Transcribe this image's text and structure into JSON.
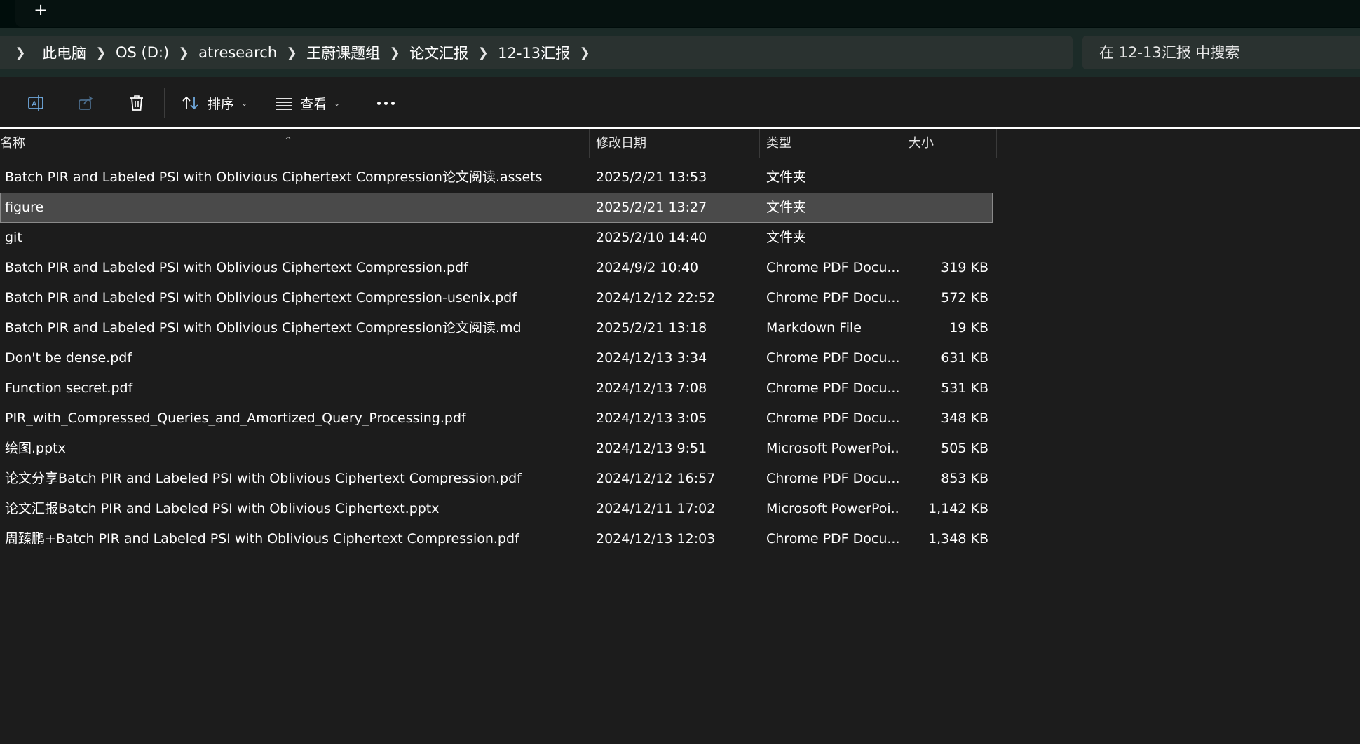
{
  "titlebar": {
    "new_tab_label": "+"
  },
  "address": {
    "breadcrumbs": [
      "此电脑",
      "OS (D:)",
      "atresearch",
      "王蔚课题组",
      "论文汇报",
      "12-13汇报"
    ],
    "search_placeholder": "在 12-13汇报 中搜索"
  },
  "toolbar": {
    "rename_icon": "rename-icon",
    "share_icon": "share-icon",
    "delete_icon": "trash-icon",
    "sort_label": "排序",
    "view_label": "查看",
    "more_icon": "more-icon"
  },
  "columns": {
    "name": "名称",
    "date": "修改日期",
    "type": "类型",
    "size": "大小"
  },
  "files": [
    {
      "name": "Batch PIR and Labeled PSI with Oblivious Ciphertext Compression论文阅读.assets",
      "date": "2025/2/21 13:53",
      "type": "文件夹",
      "size": ""
    },
    {
      "name": "figure",
      "date": "2025/2/21 13:27",
      "type": "文件夹",
      "size": "",
      "selected": true
    },
    {
      "name": "git",
      "date": "2025/2/10 14:40",
      "type": "文件夹",
      "size": ""
    },
    {
      "name": "Batch PIR and Labeled PSI with Oblivious Ciphertext Compression.pdf",
      "date": "2024/9/2 10:40",
      "type": "Chrome PDF Docu...",
      "size": "319 KB"
    },
    {
      "name": "Batch PIR and Labeled PSI with Oblivious Ciphertext Compression-usenix.pdf",
      "date": "2024/12/12 22:52",
      "type": "Chrome PDF Docu...",
      "size": "572 KB"
    },
    {
      "name": "Batch PIR and Labeled PSI with Oblivious Ciphertext Compression论文阅读.md",
      "date": "2025/2/21 13:18",
      "type": "Markdown File",
      "size": "19 KB"
    },
    {
      "name": "Don't be dense.pdf",
      "date": "2024/12/13 3:34",
      "type": "Chrome PDF Docu...",
      "size": "631 KB"
    },
    {
      "name": "Function secret.pdf",
      "date": "2024/12/13 7:08",
      "type": "Chrome PDF Docu...",
      "size": "531 KB"
    },
    {
      "name": "PIR_with_Compressed_Queries_and_Amortized_Query_Processing.pdf",
      "date": "2024/12/13 3:05",
      "type": "Chrome PDF Docu...",
      "size": "348 KB"
    },
    {
      "name": "绘图.pptx",
      "date": "2024/12/13 9:51",
      "type": "Microsoft PowerPoi...",
      "size": "505 KB"
    },
    {
      "name": "论文分享Batch PIR and Labeled PSI with Oblivious Ciphertext Compression.pdf",
      "date": "2024/12/12 16:57",
      "type": "Chrome PDF Docu...",
      "size": "853 KB"
    },
    {
      "name": "论文汇报Batch PIR and Labeled PSI with Oblivious Ciphertext.pptx",
      "date": "2024/12/11 17:02",
      "type": "Microsoft PowerPoi...",
      "size": "1,142 KB"
    },
    {
      "name": "周臻鹏+Batch PIR and Labeled PSI with Oblivious Ciphertext Compression.pdf",
      "date": "2024/12/13 12:03",
      "type": "Chrome PDF Docu...",
      "size": "1,348 KB"
    }
  ]
}
